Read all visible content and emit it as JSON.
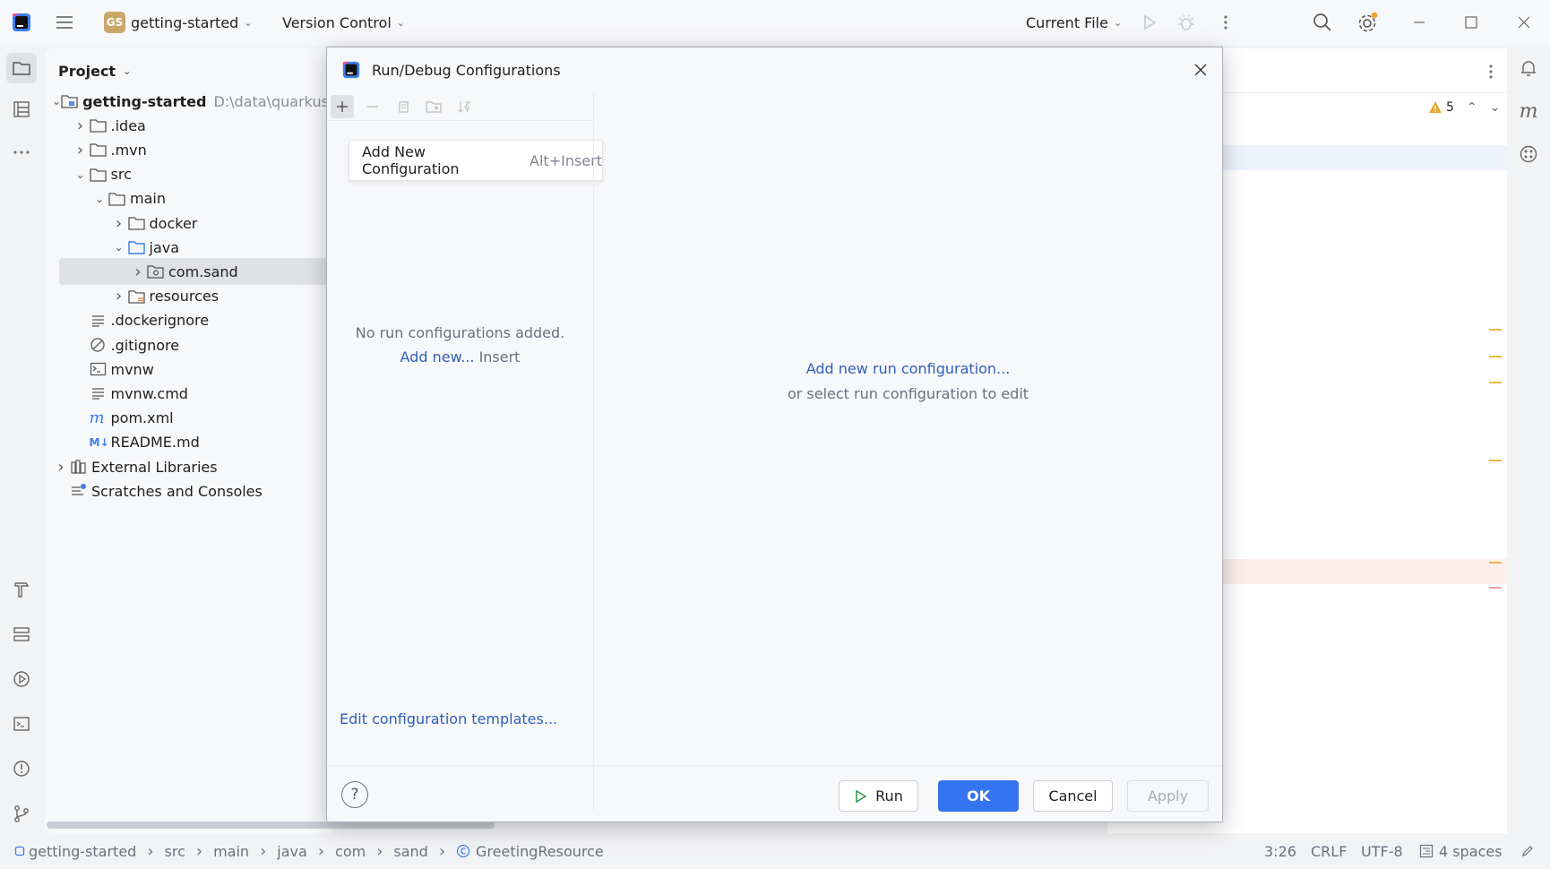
{
  "titlebar": {
    "project_badge": "GS",
    "project_name": "getting-started",
    "vcs": "Version Control",
    "run_target": "Current File"
  },
  "project_panel": {
    "title": "Project",
    "tree": [
      {
        "label": "getting-started",
        "path": "D:\\data\\quarkus-t",
        "depth": 0,
        "expanded": true,
        "icon": "module-icon",
        "bold": true
      },
      {
        "label": ".idea",
        "depth": 1,
        "expanded": false,
        "icon": "folder-icon"
      },
      {
        "label": ".mvn",
        "depth": 1,
        "expanded": false,
        "icon": "folder-icon"
      },
      {
        "label": "src",
        "depth": 1,
        "expanded": true,
        "icon": "folder-icon"
      },
      {
        "label": "main",
        "depth": 2,
        "expanded": true,
        "icon": "folder-icon"
      },
      {
        "label": "docker",
        "depth": 3,
        "expanded": false,
        "icon": "folder-icon"
      },
      {
        "label": "java",
        "depth": 3,
        "expanded": true,
        "icon": "source-folder-icon"
      },
      {
        "label": "com.sand",
        "depth": 4,
        "expanded": false,
        "icon": "package-icon",
        "selected": true
      },
      {
        "label": "resources",
        "depth": 3,
        "expanded": false,
        "icon": "resources-folder-icon"
      },
      {
        "label": ".dockerignore",
        "depth": 1,
        "icon": "text-file-icon"
      },
      {
        "label": ".gitignore",
        "depth": 1,
        "icon": "ignore-file-icon"
      },
      {
        "label": "mvnw",
        "depth": 1,
        "icon": "shell-file-icon"
      },
      {
        "label": "mvnw.cmd",
        "depth": 1,
        "icon": "text-file-icon"
      },
      {
        "label": "pom.xml",
        "depth": 1,
        "icon": "maven-file-icon"
      },
      {
        "label": "README.md",
        "depth": 1,
        "icon": "markdown-file-icon"
      },
      {
        "label": "External Libraries",
        "depth": 0,
        "expanded": false,
        "icon": "library-icon"
      },
      {
        "label": "Scratches and Consoles",
        "depth": 0,
        "icon": "scratches-icon"
      }
    ]
  },
  "editor": {
    "warnings_count": "5"
  },
  "dialog": {
    "title": "Run/Debug Configurations",
    "popup_label": "Add New Configuration",
    "popup_shortcut": "Alt+Insert",
    "empty_text": "No run configurations added.",
    "add_new_link": "Add new...",
    "add_new_shortcut": "Insert",
    "templates_link": "Edit configuration templates...",
    "right_link": "Add new run configuration...",
    "right_hint": "or select run configuration to edit",
    "buttons": {
      "run": "Run",
      "ok": "OK",
      "cancel": "Cancel",
      "apply": "Apply"
    },
    "help": "?"
  },
  "statusbar": {
    "breadcrumbs": [
      "getting-started",
      "src",
      "main",
      "java",
      "com",
      "sand",
      "GreetingResource"
    ],
    "position": "3:26",
    "line_sep": "CRLF",
    "encoding": "UTF-8",
    "indent": "4 spaces"
  },
  "colors": {
    "accent": "#3574f0",
    "link": "#2f5fb5",
    "warning": "#e8b84a"
  }
}
